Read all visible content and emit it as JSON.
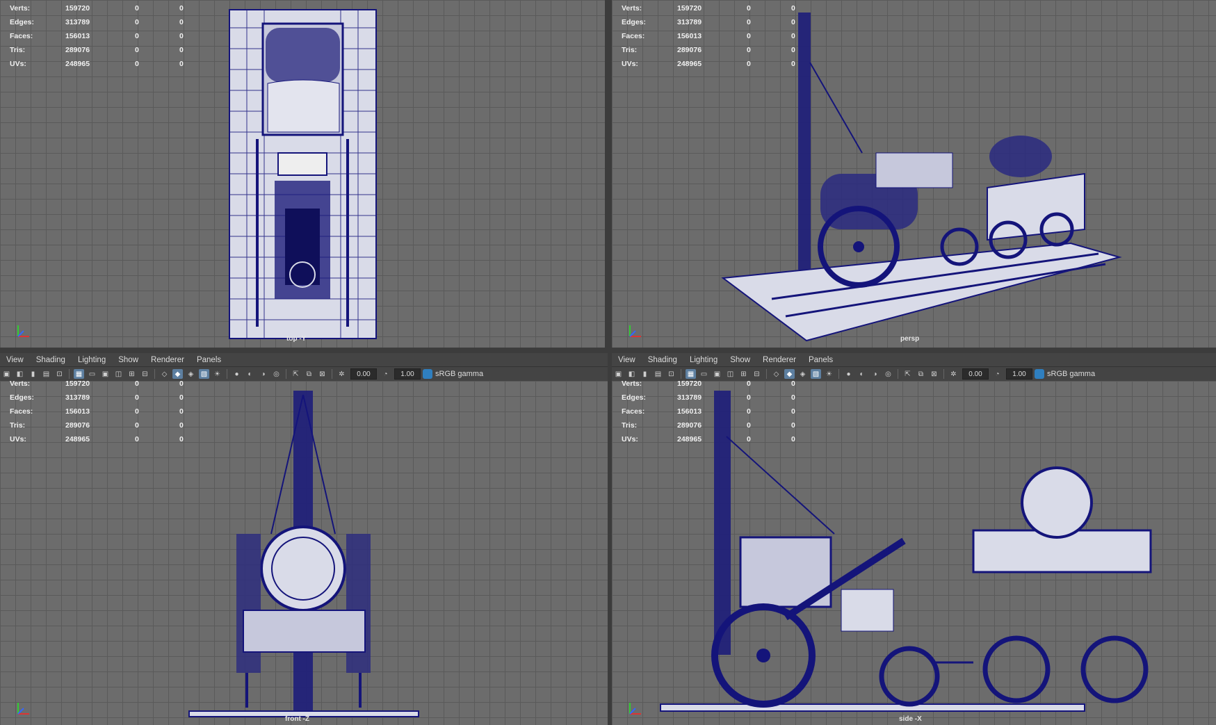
{
  "stats": {
    "rows": [
      {
        "label": "Verts:",
        "v1": "159720",
        "v2": "0",
        "v3": "0"
      },
      {
        "label": "Edges:",
        "v1": "313789",
        "v2": "0",
        "v3": "0"
      },
      {
        "label": "Faces:",
        "v1": "156013",
        "v2": "0",
        "v3": "0"
      },
      {
        "label": "Tris:",
        "v1": "289076",
        "v2": "0",
        "v3": "0"
      },
      {
        "label": "UVs:",
        "v1": "248965",
        "v2": "0",
        "v3": "0"
      }
    ]
  },
  "menus": [
    "View",
    "Shading",
    "Lighting",
    "Show",
    "Renderer",
    "Panels"
  ],
  "toolbar": {
    "exposure": "0.00",
    "gamma_value": "1.00",
    "color_space": "sRGB gamma"
  },
  "viewports": {
    "top": "top -Y",
    "persp": "persp",
    "front": "front -Z",
    "side": "side -X"
  },
  "colors": {
    "wire": "#14147a",
    "model_fill": "#d9dbe8",
    "grid_bg": "#6c6c6c",
    "accent": "#5d7fa0"
  }
}
